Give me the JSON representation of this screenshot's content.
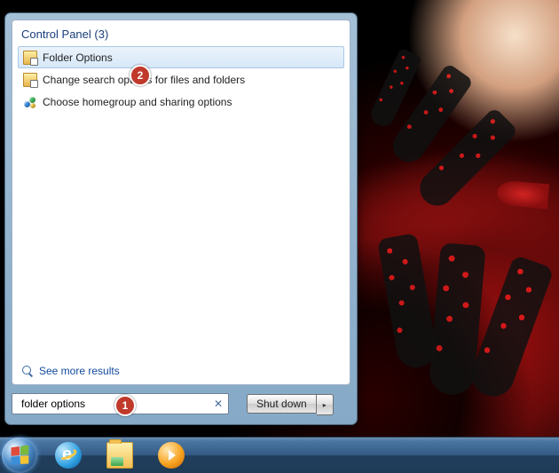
{
  "start_menu": {
    "group_header": "Control Panel (3)",
    "results": [
      {
        "label": "Folder Options",
        "selected": true,
        "icon": "folder-options-icon"
      },
      {
        "label": "Change search options for files and folders",
        "selected": false,
        "icon": "folder-options-icon"
      },
      {
        "label": "Choose homegroup and sharing options",
        "selected": false,
        "icon": "homegroup-icon"
      }
    ],
    "see_more_label": "See more results",
    "search_value": "folder options",
    "shutdown_label": "Shut down"
  },
  "annotations": {
    "badge1": "1",
    "badge2": "2"
  }
}
